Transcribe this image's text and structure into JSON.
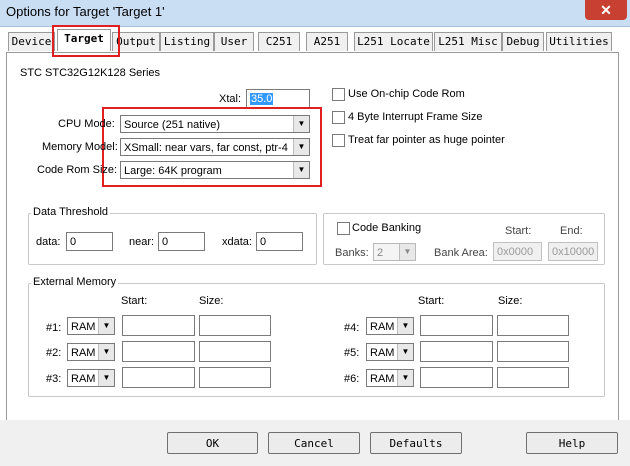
{
  "window": {
    "title": "Options for Target 'Target 1'",
    "close_glyph": "✕"
  },
  "tabs": [
    "Device",
    "Target",
    "Output",
    "Listing",
    "User",
    "C251",
    "A251",
    "L251 Locate",
    "L251 Misc",
    "Debug",
    "Utilities"
  ],
  "target": {
    "series": "STC STC32G12K128 Series",
    "xtal_label": "Xtal:",
    "xtal_value": "35.0",
    "cpu_mode_label": "CPU Mode:",
    "cpu_mode_value": "Source (251 native)",
    "memory_model_label": "Memory Model:",
    "memory_model_value": "XSmall: near vars, far const, ptr-4",
    "code_rom_size_label": "Code Rom Size:",
    "code_rom_size_value": "Large: 64K program",
    "options": [
      "Use On-chip Code Rom",
      "4 Byte Interrupt Frame Size",
      "Treat far pointer as huge pointer"
    ]
  },
  "data_threshold": {
    "title": "Data Threshold",
    "data_label": "data:",
    "data_value": "0",
    "near_label": "near:",
    "near_value": "0",
    "xdata_label": "xdata:",
    "xdata_value": "0"
  },
  "code_banking": {
    "label": "Code Banking",
    "start_label": "Start:",
    "end_label": "End:",
    "banks_label": "Banks:",
    "banks_value": "2",
    "bank_area_label": "Bank Area:",
    "bank_area_start": "0x0000",
    "bank_area_end": "0x10000"
  },
  "external_memory": {
    "title": "External Memory",
    "start_label": "Start:",
    "size_label": "Size:",
    "rows": [
      {
        "label": "#1:",
        "type": "RAM"
      },
      {
        "label": "#2:",
        "type": "RAM"
      },
      {
        "label": "#3:",
        "type": "RAM"
      },
      {
        "label": "#4:",
        "type": "RAM"
      },
      {
        "label": "#5:",
        "type": "RAM"
      },
      {
        "label": "#6:",
        "type": "RAM"
      }
    ]
  },
  "buttons": {
    "ok": "OK",
    "cancel": "Cancel",
    "defaults": "Defaults",
    "help": "Help"
  }
}
